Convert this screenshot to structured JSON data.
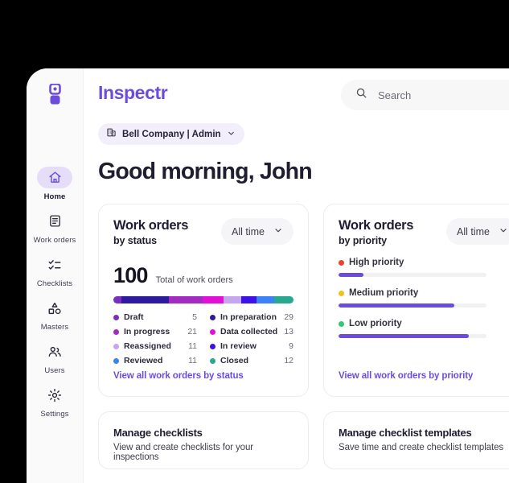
{
  "brand": {
    "wordmark": "Inspectr",
    "logo_icon": "inspectr-logo-icon",
    "accent": "#6C4DDB"
  },
  "search": {
    "placeholder": "Search",
    "value": "",
    "icon": "search-icon"
  },
  "sidebar": {
    "items": [
      {
        "label": "Home",
        "icon": "home-icon",
        "active": true
      },
      {
        "label": "Work orders",
        "icon": "document-icon",
        "active": false
      },
      {
        "label": "Checklists",
        "icon": "checklist-icon",
        "active": false
      },
      {
        "label": "Masters",
        "icon": "shapes-icon",
        "active": false
      },
      {
        "label": "Users",
        "icon": "users-icon",
        "active": false
      },
      {
        "label": "Settings",
        "icon": "gear-icon",
        "active": false
      }
    ]
  },
  "org_chip": {
    "label": "Bell Company | Admin",
    "icon": "building-icon",
    "chevron": "chevron-down-icon"
  },
  "greeting": "Good morning, John",
  "status_card": {
    "title": "Work orders",
    "subtitle": "by status",
    "range": {
      "label": "All time",
      "chevron": "chevron-down-icon"
    },
    "total": "100",
    "total_caption": "Total of work orders",
    "link": "View all work orders by status",
    "legend_left": [
      {
        "label": "Draft",
        "value": "5",
        "color": "#7B2FBE"
      },
      {
        "label": "In progress",
        "value": "21",
        "color": "#A32BC4"
      },
      {
        "label": "Reassigned",
        "value": "11",
        "color": "#C4A7F0"
      },
      {
        "label": "Reviewed",
        "value": "11",
        "color": "#3B82F6"
      }
    ],
    "legend_right": [
      {
        "label": "In preparation",
        "value": "29",
        "color": "#2E1A9E"
      },
      {
        "label": "Data collected",
        "value": "13",
        "color": "#E30FD8"
      },
      {
        "label": "In review",
        "value": "9",
        "color": "#3B11E8"
      },
      {
        "label": "Closed",
        "value": "12",
        "color": "#26A98F"
      }
    ]
  },
  "chart_data": [
    {
      "type": "bar",
      "title": "Work orders by status",
      "subtitle": "All time",
      "layout": "stacked-single-bar",
      "total": 100,
      "ylabel": "",
      "xlabel": "",
      "categories": [
        "Draft",
        "In preparation",
        "In progress",
        "Data collected",
        "Reassigned",
        "In review",
        "Reviewed",
        "Closed"
      ],
      "values": [
        5,
        29,
        21,
        13,
        11,
        9,
        11,
        12
      ],
      "colors": [
        "#7B2FBE",
        "#2E1A9E",
        "#A32BC4",
        "#E30FD8",
        "#C4A7F0",
        "#3B11E8",
        "#3B82F6",
        "#26A98F"
      ],
      "legend": "inline-two-column"
    },
    {
      "type": "bar",
      "title": "Work orders by priority",
      "subtitle": "All time",
      "layout": "horizontal-progress",
      "categories": [
        "High priority",
        "Medium priority",
        "Low priority"
      ],
      "values": [
        17,
        78,
        88
      ],
      "ylim": [
        0,
        100
      ],
      "bar_color": "#6C4DDB",
      "track_color": "#F1F1F4",
      "dot_colors": [
        "#F0402F",
        "#F2C117",
        "#2ECC71"
      ]
    }
  ],
  "priority_card": {
    "title": "Work orders",
    "subtitle": "by priority",
    "range": {
      "label": "All time",
      "chevron": "chevron-down-icon"
    },
    "link": "View all work orders by priority",
    "rows": [
      {
        "label": "High priority",
        "dot": "#F0402F",
        "percent": 17
      },
      {
        "label": "Medium priority",
        "dot": "#F2C117",
        "percent": 78
      },
      {
        "label": "Low priority",
        "dot": "#2ECC71",
        "percent": 88
      }
    ]
  },
  "bottom_cards": [
    {
      "title": "Manage checklists",
      "desc": "View and create checklists for your inspections"
    },
    {
      "title": "Manage checklist templates",
      "desc": "Save time and create checklist templates"
    }
  ]
}
